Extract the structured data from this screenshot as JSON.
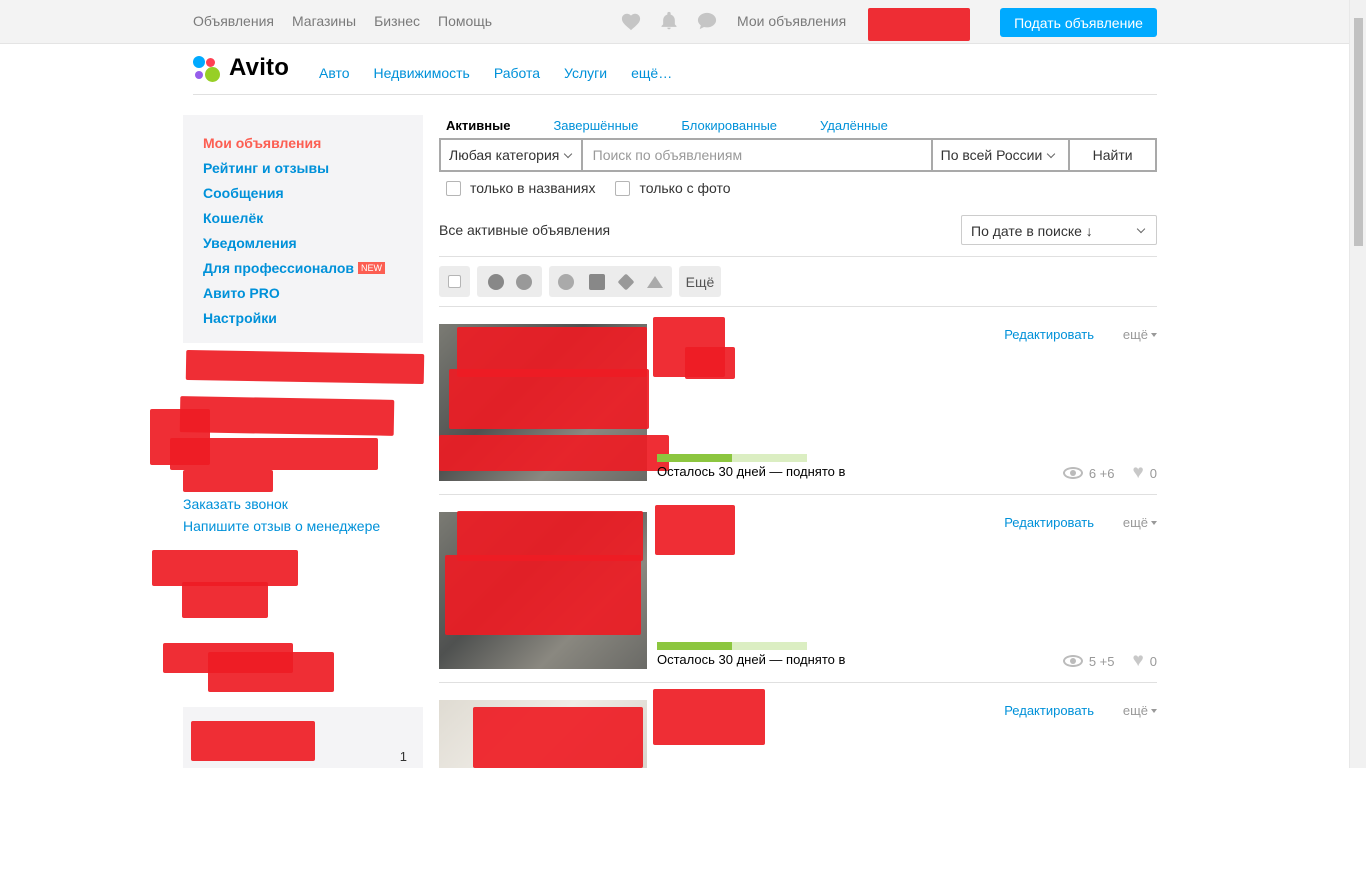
{
  "topbar": {
    "nav": [
      "Объявления",
      "Магазины",
      "Бизнес",
      "Помощь"
    ],
    "my_ads": "Мои объявления",
    "post_button": "Подать объявление"
  },
  "header": {
    "logo_text": "Avito",
    "categories": [
      "Авто",
      "Недвижимость",
      "Работа",
      "Услуги",
      "ещё…"
    ]
  },
  "sidebar": {
    "items": [
      {
        "label": "Мои объявления"
      },
      {
        "label": "Рейтинг и отзывы"
      },
      {
        "label": "Сообщения"
      },
      {
        "label": "Кошелёк"
      },
      {
        "label": "Уведомления"
      },
      {
        "label": "Для профессионалов"
      },
      {
        "label": "Авито PRO"
      },
      {
        "label": "Настройки"
      }
    ],
    "new_badge": "NEW",
    "order_call": "Заказать звонок",
    "review_manager": "Напишите отзыв о менеджере",
    "bottom_count": "1"
  },
  "tabs": [
    "Активные",
    "Завершённые",
    "Блокированные",
    "Удалённые"
  ],
  "search": {
    "category": "Любая категория",
    "placeholder": "Поиск по объявлениям",
    "region": "По всей России",
    "button": "Найти",
    "only_titles": "только в названиях",
    "only_photo": "только с фото"
  },
  "list": {
    "heading": "Все активные объявления",
    "sort": "По дате в поиске ↓",
    "more_button": "Ещё"
  },
  "items": [
    {
      "edit": "Редактировать",
      "more": "ещё",
      "remaining": "Осталось 30 дней — поднято в",
      "views": "6 +6",
      "favorites": "0",
      "progress": 0.5
    },
    {
      "edit": "Редактировать",
      "more": "ещё",
      "remaining": "Осталось 30 дней — поднято в",
      "views": "5 +5",
      "favorites": "0",
      "progress": 0.5
    },
    {
      "edit": "Редактировать",
      "more": "ещё"
    }
  ],
  "colors": {
    "accent": "#0091d9",
    "active": "#fc5e52",
    "button": "#00aaff",
    "progress": "#8cc63f"
  }
}
